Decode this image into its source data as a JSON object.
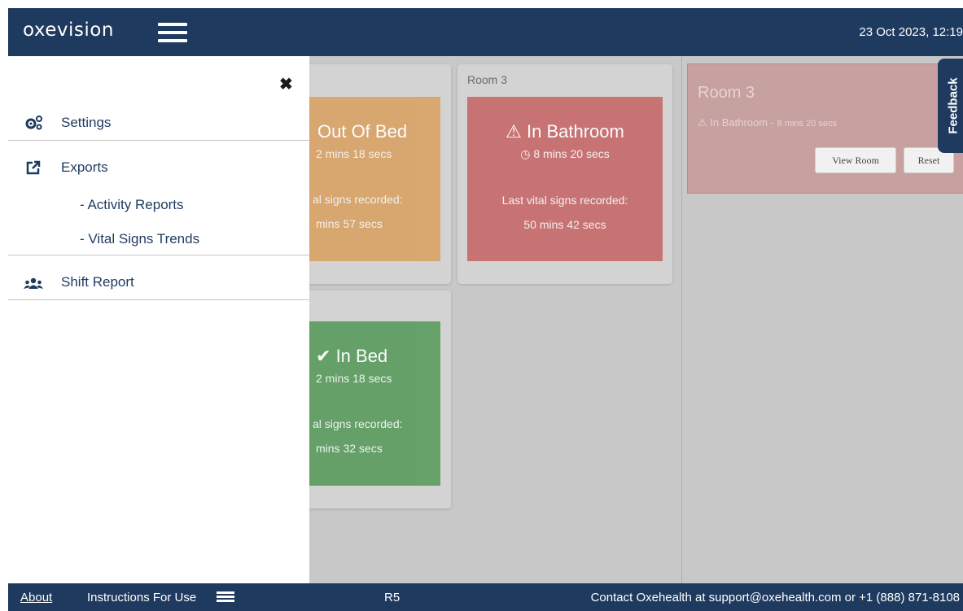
{
  "topbar": {
    "logo": "oxevision",
    "datetime": "23 Oct 2023, 12:19"
  },
  "sidemenu": {
    "items": [
      {
        "label": "Settings",
        "icon": "cogs-icon"
      },
      {
        "label": "Exports",
        "icon": "external-link-icon"
      },
      {
        "label": "Shift Report",
        "icon": "users-icon"
      }
    ],
    "export_sub": [
      "- Activity Reports",
      "- Vital Signs Trends"
    ]
  },
  "rooms": [
    {
      "label": "",
      "status": "Out Of Bed",
      "duration": "2 mins 18 secs",
      "vital_label": "al signs recorded:",
      "vital_value": "mins 57 secs",
      "color": "#d9a46a"
    },
    {
      "label": "Room 3",
      "status": "In Bathroom",
      "duration": "8 mins 20 secs",
      "vital_label": "Last vital signs recorded:",
      "vital_value": "50 mins 42 secs",
      "color": "#c86e6e"
    },
    {
      "label": "",
      "status": "In Bed",
      "duration": "2 mins 18 secs",
      "vital_label": "al signs recorded:",
      "vital_value": "mins 32 secs",
      "color": "#5f9e63"
    }
  ],
  "notification": {
    "title": "Room 3",
    "status": "In Bathroom - ",
    "duration": "8 mins 20 secs",
    "view_button": "View Room",
    "reset_button": "Reset"
  },
  "feedback": {
    "label": "Feedback"
  },
  "footer": {
    "about": "About",
    "instructions": "Instructions For Use",
    "version": "R5",
    "contact": "Contact Oxehealth at support@oxehealth.com or +1 (888) 871-8108"
  }
}
